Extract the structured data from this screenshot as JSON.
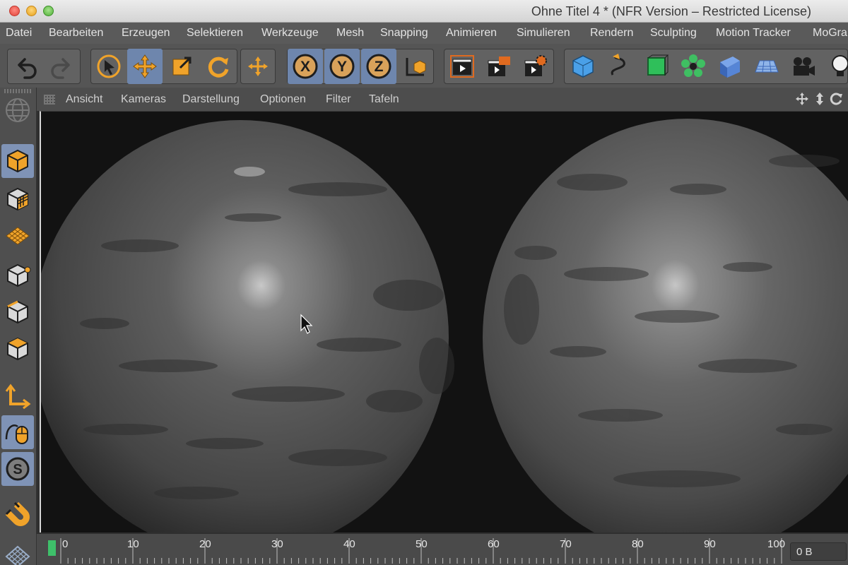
{
  "window": {
    "title": "Ohne Titel 4 * (NFR Version – Restricted License)"
  },
  "menubar": {
    "items": [
      "Datei",
      "Bearbeiten",
      "Erzeugen",
      "Selektieren",
      "Werkzeuge",
      "Mesh",
      "Snapping",
      "Animieren",
      "Simulieren",
      "Rendern",
      "Sculpting",
      "Motion Tracker",
      "MoGra"
    ]
  },
  "viewport": {
    "menus": [
      "Ansicht",
      "Kameras",
      "Darstellung",
      "Optionen",
      "Filter",
      "Tafeln"
    ]
  },
  "timeline": {
    "ticks": [
      "0",
      "10",
      "20",
      "30",
      "40",
      "50",
      "60",
      "70",
      "80",
      "90",
      "100"
    ],
    "value": "0 B"
  },
  "toolbar": {
    "icons": [
      "undo-icon",
      "redo-icon",
      "select-icon",
      "move-icon",
      "scale-icon",
      "rotate-icon",
      "add-move-icon",
      "x-axis-icon",
      "y-axis-icon",
      "z-axis-icon",
      "coordinate-system-icon",
      "render-view-icon",
      "render-picture-viewer-icon",
      "render-settings-icon",
      "cube-icon",
      "spline-pen-icon",
      "subdivision-icon",
      "cloner-icon",
      "deformer-icon",
      "floor-icon",
      "camera-icon",
      "light-icon"
    ]
  },
  "colors": {
    "accent_orange": "#f0a32a",
    "active_blue": "#6e86ad",
    "timeline_green": "#3ec06a"
  }
}
